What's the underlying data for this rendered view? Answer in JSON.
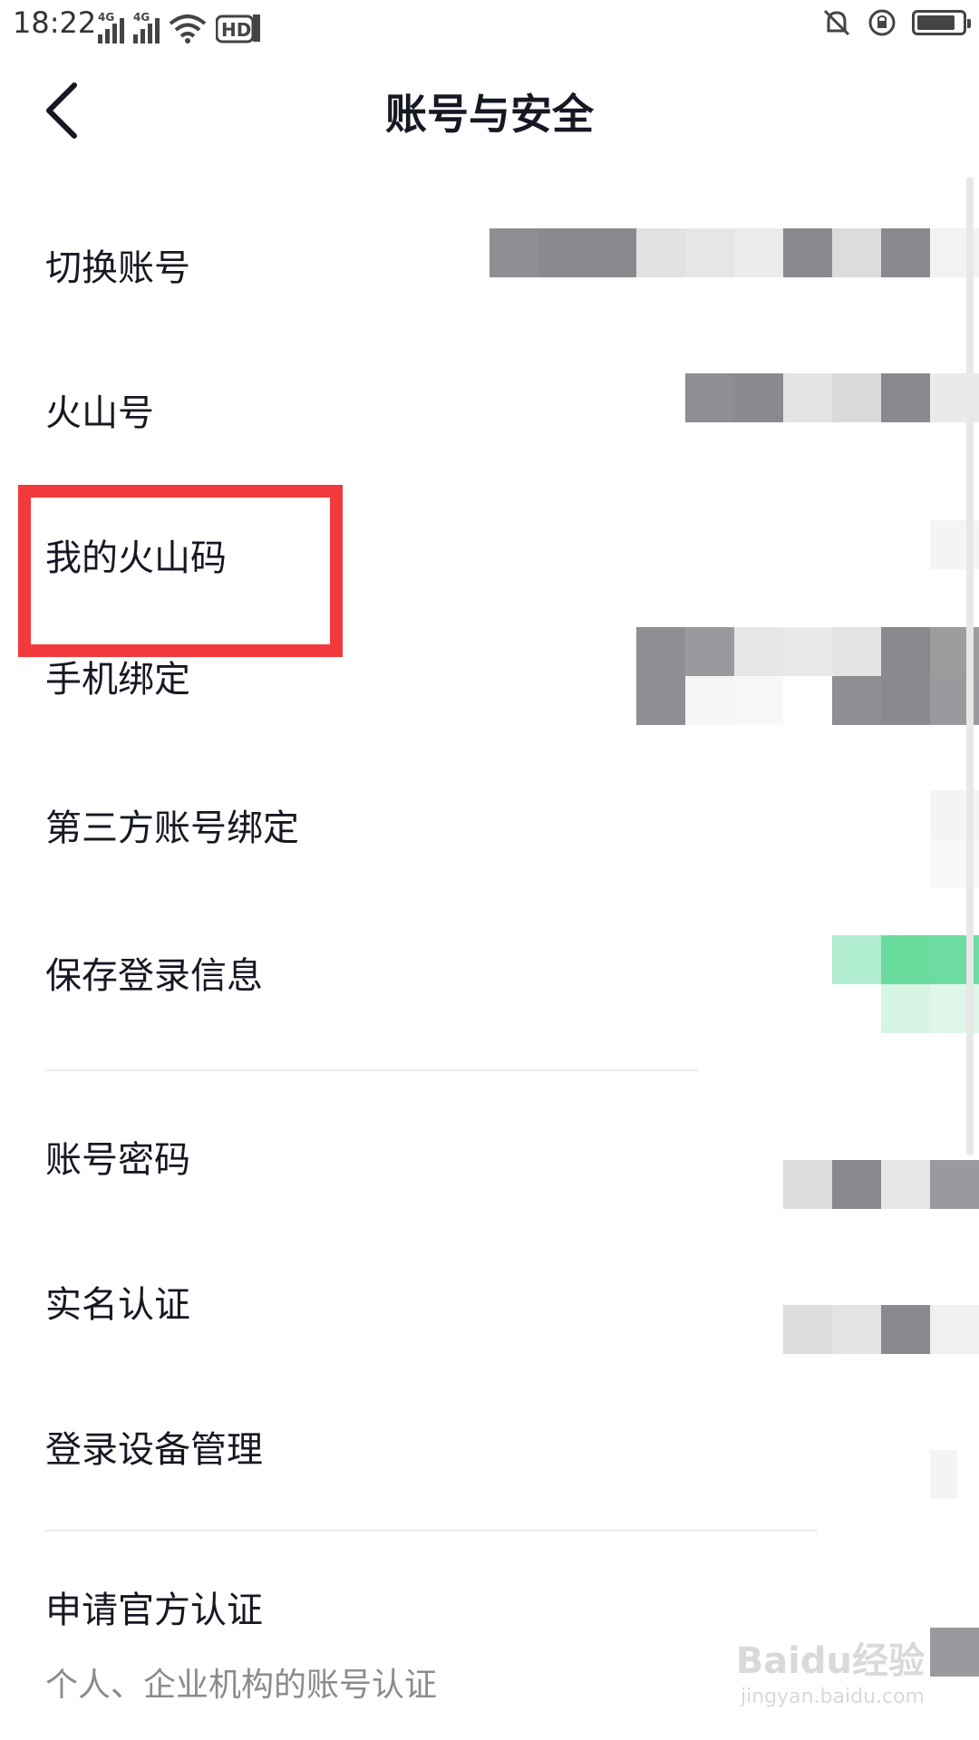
{
  "status_bar": {
    "time": "18:22",
    "network_1": "4G",
    "network_2": "4G",
    "hd_label": "HD",
    "icons": [
      "signal-icon",
      "signal-icon",
      "wifi-icon",
      "hd-voice-icon",
      "mute-bell-icon",
      "rotation-lock-icon",
      "battery-icon"
    ],
    "battery_level": 0.85
  },
  "header": {
    "title": "账号与安全",
    "back_icon": "chevron-left-icon"
  },
  "settings": [
    {
      "id": "switch-account",
      "label": "切换账号"
    },
    {
      "id": "volcano-id",
      "label": "火山号"
    },
    {
      "id": "my-volcano-code",
      "label": "我的火山码"
    },
    {
      "id": "phone-binding",
      "label": "手机绑定"
    },
    {
      "id": "third-party-binding",
      "label": "第三方账号绑定"
    },
    {
      "id": "save-login-info",
      "label": "保存登录信息"
    },
    {
      "id": "account-password",
      "label": "账号密码"
    },
    {
      "id": "real-name-verification",
      "label": "实名认证"
    },
    {
      "id": "login-device-management",
      "label": "登录设备管理"
    },
    {
      "id": "official-verification",
      "label": "申请官方认证",
      "subtitle": "个人、企业机构的账号认证"
    }
  ],
  "watermark": {
    "text": "Baidu经验",
    "sub": "jingyan.baidu.com"
  },
  "colors": {
    "highlight": "#f23a3c",
    "toggle_green": "#69db9c",
    "text": "#161823",
    "subtext": "#8a8b91"
  }
}
